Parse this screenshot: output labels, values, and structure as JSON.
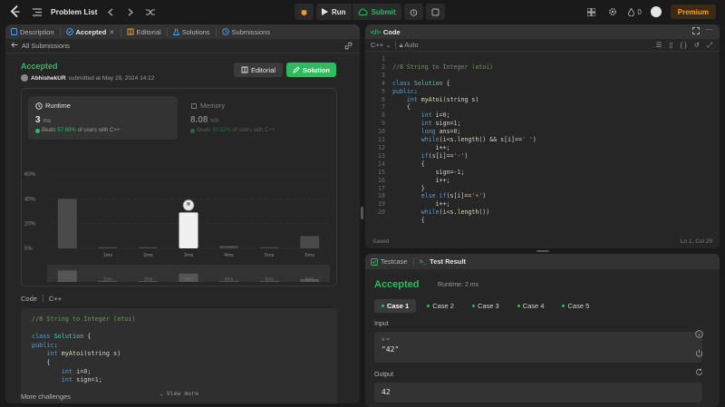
{
  "nav": {
    "title": "Problem List",
    "run_label": "Run",
    "submit_label": "Submit",
    "streak": "0",
    "premium_label": "Premium"
  },
  "left": {
    "tabs": [
      {
        "label": "Description"
      },
      {
        "label": "Accepted"
      },
      {
        "label": "Editorial"
      },
      {
        "label": "Solutions"
      },
      {
        "label": "Submissions"
      }
    ],
    "back_label": "All Submissions",
    "status": "Accepted",
    "user": "AbhishekUR",
    "submitted_text": "submitted at May 29, 2024 14:12",
    "editorial_btn": "Editorial",
    "solution_btn": "Solution",
    "runtime": {
      "label": "Runtime",
      "value": "3",
      "unit": "ms",
      "beats_prefix": "Beats",
      "beats_pct": "57.69%",
      "beats_suffix": "of users with C++"
    },
    "memory": {
      "label": "Memory",
      "value": "8.08",
      "unit": "MB",
      "beats_prefix": "Beats",
      "beats_pct": "93.02%",
      "beats_suffix": "of users with C++"
    },
    "code_label": "Code",
    "code_lang": "C++",
    "code_preview": [
      "//8 String to Integer (atoi)",
      "",
      "class Solution {",
      "public:",
      "    int myAtoi(string s)",
      "    {",
      "        int i=0;",
      "        int sign=1;"
    ],
    "view_more": "View more",
    "more_challenges": "More challenges"
  },
  "chart_data": {
    "type": "bar",
    "categories": [
      "",
      "1ms",
      "2ms",
      "3ms",
      "4ms",
      "5ms",
      "6ms"
    ],
    "values": [
      40,
      1,
      1,
      29,
      2,
      1,
      10
    ],
    "highlight_index": 3,
    "yticks": [
      "0%",
      "20%",
      "40%",
      "60%"
    ],
    "ylim": [
      0,
      60
    ],
    "grid": true
  },
  "editor": {
    "title": "Code",
    "language": "C++",
    "mode": "Auto",
    "status_left": "Saved",
    "status_right": "Ln 1, Col 29",
    "lines": [
      "//8 String to Integer (atoi)",
      "",
      "class Solution {",
      "public:",
      "    int myAtoi(string s)",
      "    {",
      "        int i=0;",
      "        int sign=1;",
      "        long ans=0;",
      "        while(i<s.length() && s[i]==' ')",
      "            i++;",
      "        if(s[i]=='-')",
      "        {",
      "            sign=-1;",
      "            i++;",
      "        }",
      "        else if(s[i]=='+')",
      "            i++;",
      "        while(i<s.length())",
      "        {"
    ]
  },
  "test": {
    "tab_testcase": "Testcase",
    "tab_result": "Test Result",
    "status": "Accepted",
    "runtime": "Runtime: 2 ms",
    "cases": [
      "Case 1",
      "Case 2",
      "Case 3",
      "Case 4",
      "Case 5"
    ],
    "input_label": "Input",
    "input_var": "s =",
    "input_value": "\"42\"",
    "output_label": "Output",
    "output_value": "42"
  }
}
